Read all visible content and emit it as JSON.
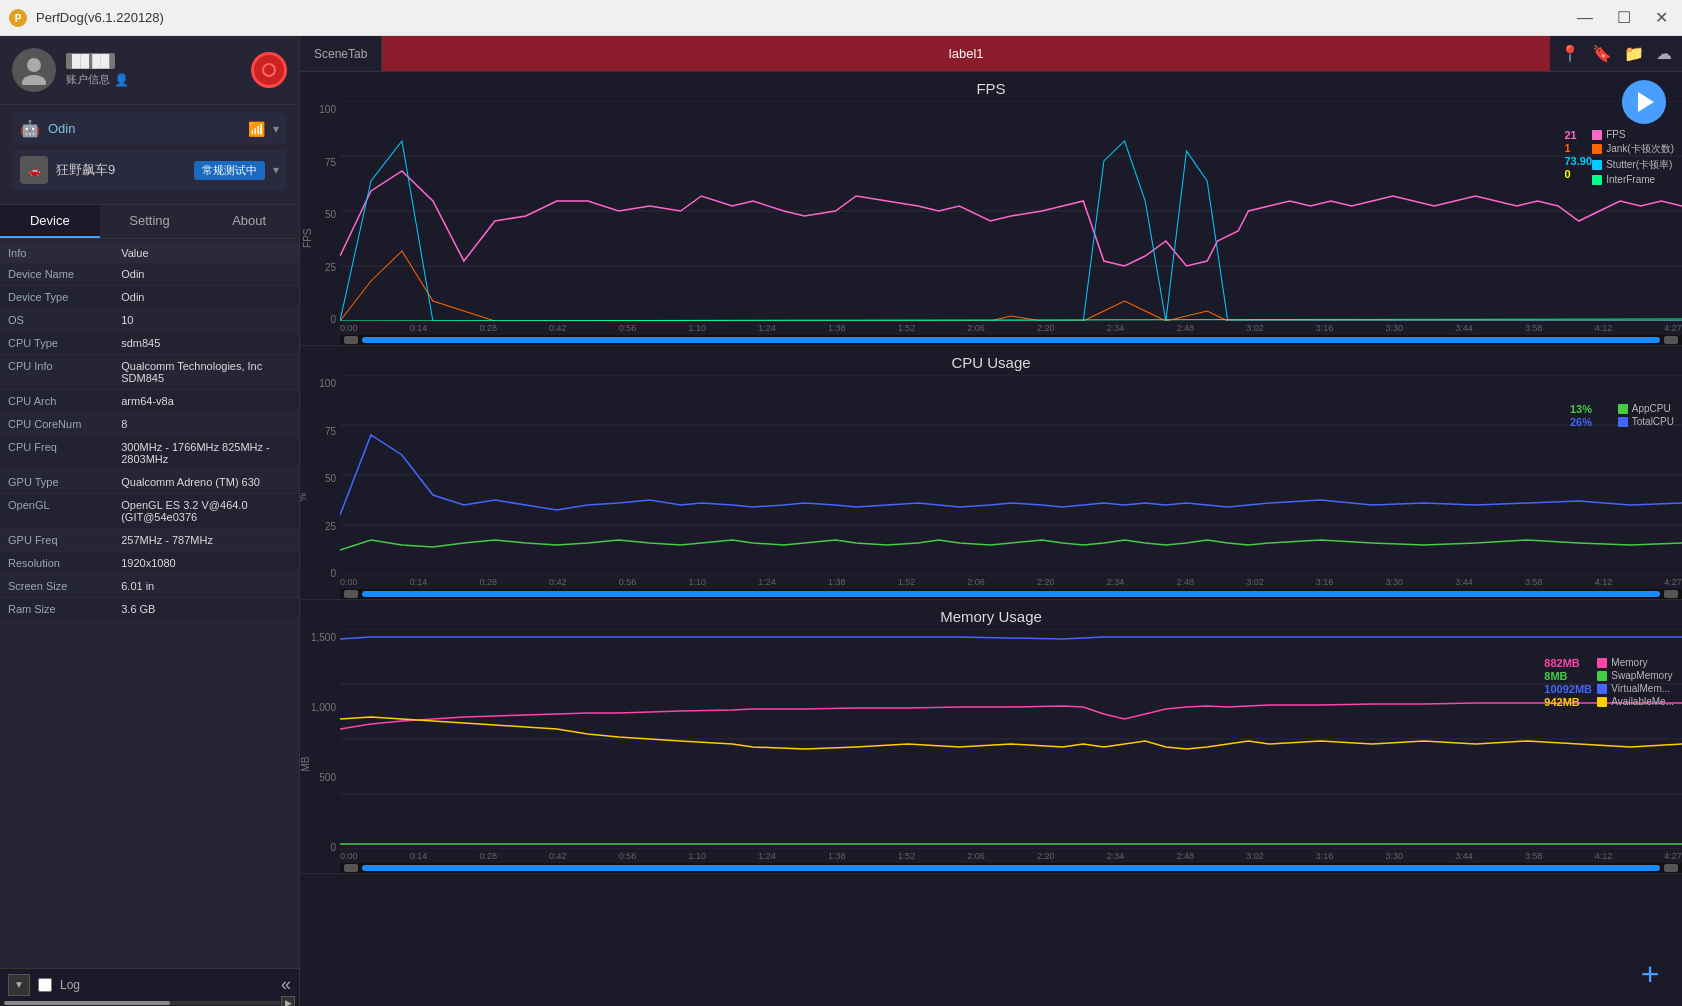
{
  "titlebar": {
    "title": "PerfDog(v6.1.220128)",
    "minimize": "—",
    "maximize": "☐",
    "close": "✕"
  },
  "sidebar": {
    "username": "██ ██",
    "account_info": "账户信息",
    "device_name": "Odin",
    "device_icon": "📱",
    "game_name": "狂野飙车9",
    "game_mode": "常规测试中",
    "tabs": [
      "Device",
      "Setting",
      "About"
    ],
    "active_tab": "Device",
    "info_header": {
      "col1": "Info",
      "col2": "Value"
    },
    "info_rows": [
      {
        "key": "Device Name",
        "value": "Odin"
      },
      {
        "key": "Device Type",
        "value": "Odin"
      },
      {
        "key": "OS",
        "value": "10"
      },
      {
        "key": "CPU Type",
        "value": "sdm845"
      },
      {
        "key": "CPU Info",
        "value": "Qualcomm Technologies, Inc SDM845"
      },
      {
        "key": "CPU Arch",
        "value": "arm64-v8a"
      },
      {
        "key": "CPU CoreNum",
        "value": "8"
      },
      {
        "key": "CPU Freq",
        "value": "300MHz - 1766MHz 825MHz - 2803MHz"
      },
      {
        "key": "GPU Type",
        "value": "Qualcomm Adreno (TM) 630"
      },
      {
        "key": "OpenGL",
        "value": "OpenGL ES 3.2 V@464.0 (GIT@54e0376"
      },
      {
        "key": "GPU Freq",
        "value": "257MHz - 787MHz"
      },
      {
        "key": "Resolution",
        "value": "1920x1080"
      },
      {
        "key": "Screen Size",
        "value": "6.01 in"
      },
      {
        "key": "Ram Size",
        "value": "3.6 GB"
      }
    ],
    "collapse_icon": "«",
    "log_label": "Log"
  },
  "scene_tab": {
    "label": "SceneTab",
    "active": "label1"
  },
  "fps_chart": {
    "title": "FPS",
    "y_labels": [
      "100",
      "75",
      "50",
      "25",
      "0"
    ],
    "y_axis_title": "FPS",
    "x_labels": [
      "0:00",
      "0:14",
      "0:28",
      "0:42",
      "0:56",
      "1:10",
      "1:24",
      "1:38",
      "1:52",
      "2:06",
      "2:20",
      "2:34",
      "2:48",
      "3:02",
      "3:16",
      "3:30",
      "3:44",
      "3:58",
      "4:12",
      "4:27"
    ],
    "values": {
      "current": "21",
      "val2": "1",
      "val3": "73.90",
      "val4": "0"
    },
    "legend": [
      {
        "color": "#ff66cc",
        "label": "FPS"
      },
      {
        "color": "#ff6600",
        "label": "Jank(卡顿次数)"
      },
      {
        "color": "#00ccff",
        "label": "Stutter(卡顿率)"
      },
      {
        "color": "#00ff88",
        "label": "InterFrame"
      }
    ],
    "value_colors": [
      "#ff66cc",
      "#ff6600",
      "#00ccff",
      "#ffff00"
    ]
  },
  "cpu_chart": {
    "title": "CPU Usage",
    "y_labels": [
      "100",
      "75",
      "50",
      "25",
      "0"
    ],
    "y_axis_title": "%",
    "x_labels": [
      "0:00",
      "0:14",
      "0:28",
      "0:42",
      "0:56",
      "1:10",
      "1:24",
      "1:38",
      "1:52",
      "2:06",
      "2:20",
      "2:34",
      "2:48",
      "3:02",
      "3:16",
      "3:30",
      "3:44",
      "3:58",
      "4:12",
      "4:27"
    ],
    "values": {
      "app_cpu": "13%",
      "total_cpu": "26%"
    },
    "legend": [
      {
        "color": "#44cc44",
        "label": "AppCPU"
      },
      {
        "color": "#4466ff",
        "label": "TotalCPU"
      }
    ],
    "value_colors": [
      "#44cc44",
      "#4466ff"
    ]
  },
  "memory_chart": {
    "title": "Memory Usage",
    "y_labels": [
      "1,500",
      "1,000",
      "500",
      "0"
    ],
    "y_axis_title": "MB",
    "x_labels": [
      "0:00",
      "0:14",
      "0:28",
      "0:42",
      "0:56",
      "1:10",
      "1:24",
      "1:38",
      "1:52",
      "2:06",
      "2:20",
      "2:34",
      "2:48",
      "3:02",
      "3:16",
      "3:30",
      "3:44",
      "3:58",
      "4:12",
      "4:27"
    ],
    "values": {
      "memory": "882MB",
      "swap": "8MB",
      "virtual": "10092MB",
      "available": "942MB"
    },
    "legend": [
      {
        "color": "#ff44aa",
        "label": "Memory"
      },
      {
        "color": "#44cc44",
        "label": "SwapMemory"
      },
      {
        "color": "#4466ff",
        "label": "VirtualMem..."
      },
      {
        "color": "#ffcc00",
        "label": "AvailableMe..."
      }
    ],
    "value_colors": [
      "#ff44aa",
      "#44cc44",
      "#4466ff",
      "#ffcc00"
    ]
  }
}
